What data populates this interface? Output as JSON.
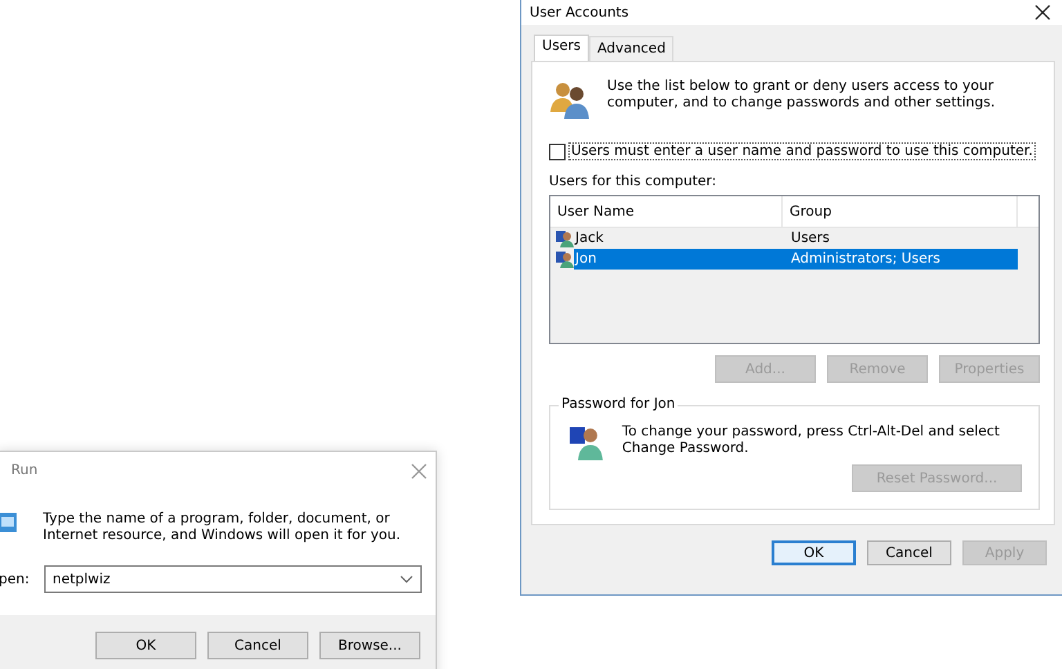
{
  "run_dialog": {
    "title": "Run",
    "description": "Type the name of a program, folder, document, or Internet resource, and Windows will open it for you.",
    "open_label": "pen:",
    "open_value": "netplwiz",
    "buttons": [
      {
        "label": "OK",
        "disabled": false,
        "focused": false
      },
      {
        "label": "Cancel",
        "disabled": false,
        "focused": false
      },
      {
        "label": "Browse...",
        "disabled": false,
        "focused": false
      }
    ]
  },
  "user_accounts": {
    "title": "User Accounts",
    "tabs": [
      {
        "label": "Users",
        "selected": true
      },
      {
        "label": "Advanced",
        "selected": false
      }
    ],
    "intro": "Use the list below to grant or deny users access to your computer, and to change passwords and other settings.",
    "require_password": {
      "label": "Users must enter a user name and password to use this computer.",
      "checked": false
    },
    "list_label": "Users for this computer:",
    "table": {
      "columns": [
        "User Name",
        "Group"
      ],
      "rows": [
        {
          "cells": [
            "Jack",
            "Users"
          ],
          "selected": false
        },
        {
          "cells": [
            "Jon",
            "Administrators; Users"
          ],
          "selected": true
        }
      ]
    },
    "list_buttons": [
      {
        "label": "Add...",
        "disabled": true,
        "focused": false
      },
      {
        "label": "Remove",
        "disabled": true,
        "focused": false
      },
      {
        "label": "Properties",
        "disabled": true,
        "focused": false
      }
    ],
    "password_group": {
      "title": "Password for Jon",
      "text": "To change your password, press Ctrl-Alt-Del and select Change Password.",
      "button": {
        "label": "Reset Password...",
        "disabled": true,
        "focused": false
      }
    },
    "buttons": [
      {
        "label": "OK",
        "disabled": false,
        "focused": true
      },
      {
        "label": "Cancel",
        "disabled": false,
        "focused": false
      },
      {
        "label": "Apply",
        "disabled": true,
        "focused": false
      }
    ]
  }
}
